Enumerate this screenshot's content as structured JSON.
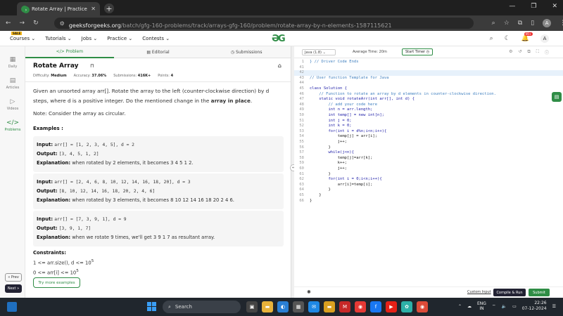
{
  "browser": {
    "tab_title": "Rotate Array | Practice | GeeksforGeeks",
    "url_host": "geeksforgeeks.org",
    "url_path": "/batch/gfg-160-problems/track/arrays-gfg-160/problem/rotate-array-by-n-elements-1587115621",
    "profile_initial": "A"
  },
  "gfg_nav": {
    "sale_badge": "SALE",
    "items": [
      "Courses",
      "Tutorials",
      "Jobs",
      "Practice",
      "Contests"
    ],
    "notif_count": "99+",
    "user_initial": "A"
  },
  "rail": {
    "items": [
      "Daily",
      "Articles",
      "Videos",
      "Problems"
    ],
    "prev": "« Prev",
    "next": "Next »"
  },
  "problem_tabs": [
    "Problem",
    "Editorial",
    "Submissions"
  ],
  "problem": {
    "title": "Rotate Array",
    "difficulty_label": "Difficulty:",
    "difficulty": "Medium",
    "accuracy_label": "Accuracy:",
    "accuracy": "37.06%",
    "submissions_label": "Submissions:",
    "submissions": "416K+",
    "points_label": "Points:",
    "points": "4",
    "desc_1": "Given an unsorted array arr[]. Rotate the array to the left (counter-clockwise direction) by d steps, where d is a positive integer. Do the mentioned change in the ",
    "desc_bold": "array in place",
    "desc_end": ".",
    "note": "Note: Consider the array as circular.",
    "examples_head": "Examples :",
    "examples": [
      {
        "input": "arr[] = [1, 2, 3, 4, 5], d = 2",
        "output": "[3, 4, 5, 1, 2]",
        "explanation": "when rotated by 2 elements, it becomes 3 4 5 1 2."
      },
      {
        "input": "arr[] = [2, 4, 6, 8, 10, 12, 14, 16, 18, 20], d = 3",
        "output": "[8, 10, 12, 14, 16, 18, 20, 2, 4, 6]",
        "explanation": "when rotated by 3 elements, it becomes 8 10 12 14 16 18 20 2 4 6."
      },
      {
        "input": "arr[] = [7, 3, 9, 1], d = 9",
        "output": "[3, 9, 1, 7]",
        "explanation": "when we rotate 9 times, we'll get 3 9 1 7 as resultant array."
      }
    ],
    "input_label": "Input:",
    "output_label": "Output:",
    "explanation_label": "Explanation:",
    "constraints_head": "Constraints:",
    "constraint_1": "1 <= arr.size(), d <= 10",
    "constraint_1_exp": "5",
    "constraint_2": "0 <= arr[i] <= 10",
    "constraint_2_exp": "5",
    "try_more": "Try more examples"
  },
  "editor": {
    "language": "Java (1.8)",
    "avg_time": "Average Time: 20m",
    "timer": "Start Timer",
    "lines": [
      {
        "n": "1",
        "t": "} // Driver Code Ends"
      },
      {
        "n": "41",
        "t": ""
      },
      {
        "n": "42",
        "t": ""
      },
      {
        "n": "43",
        "t": "// User function Template for Java"
      },
      {
        "n": "44",
        "t": ""
      },
      {
        "n": "45",
        "t": "class Solution {"
      },
      {
        "n": "46",
        "t": "    // Function to rotate an array by d elements in counter-clockwise direction."
      },
      {
        "n": "47",
        "t": "    static void rotateArr(int arr[], int d) {"
      },
      {
        "n": "48",
        "t": "        // add your code here"
      },
      {
        "n": "49",
        "t": "        int n = arr.length;"
      },
      {
        "n": "50",
        "t": "        int temp[] = new int[n];"
      },
      {
        "n": "51",
        "t": "        int j = 0;"
      },
      {
        "n": "52",
        "t": "        int k = 0;"
      },
      {
        "n": "53",
        "t": "        for(int i = d%n;i<n;i++){"
      },
      {
        "n": "54",
        "t": "            temp[j] = arr[i];"
      },
      {
        "n": "55",
        "t": "            j++;"
      },
      {
        "n": "56",
        "t": "        }"
      },
      {
        "n": "57",
        "t": "        while(j<n){"
      },
      {
        "n": "58",
        "t": "            temp[j]=arr[k];"
      },
      {
        "n": "59",
        "t": "            k++;"
      },
      {
        "n": "60",
        "t": "            j++;"
      },
      {
        "n": "61",
        "t": "        }"
      },
      {
        "n": "62",
        "t": "        for(int i = 0;i<n;i++){"
      },
      {
        "n": "63",
        "t": "            arr[i]=temp[i];"
      },
      {
        "n": "64",
        "t": "        }"
      },
      {
        "n": "65",
        "t": "    }"
      },
      {
        "n": "66",
        "t": "}"
      }
    ],
    "custom_input": "Custom Input",
    "compile": "Compile & Run",
    "submit": "Submit"
  },
  "taskbar": {
    "search": "Search",
    "lang_1": "ENG",
    "lang_2": "IN",
    "time": "22:26",
    "date": "07-12-2024"
  }
}
